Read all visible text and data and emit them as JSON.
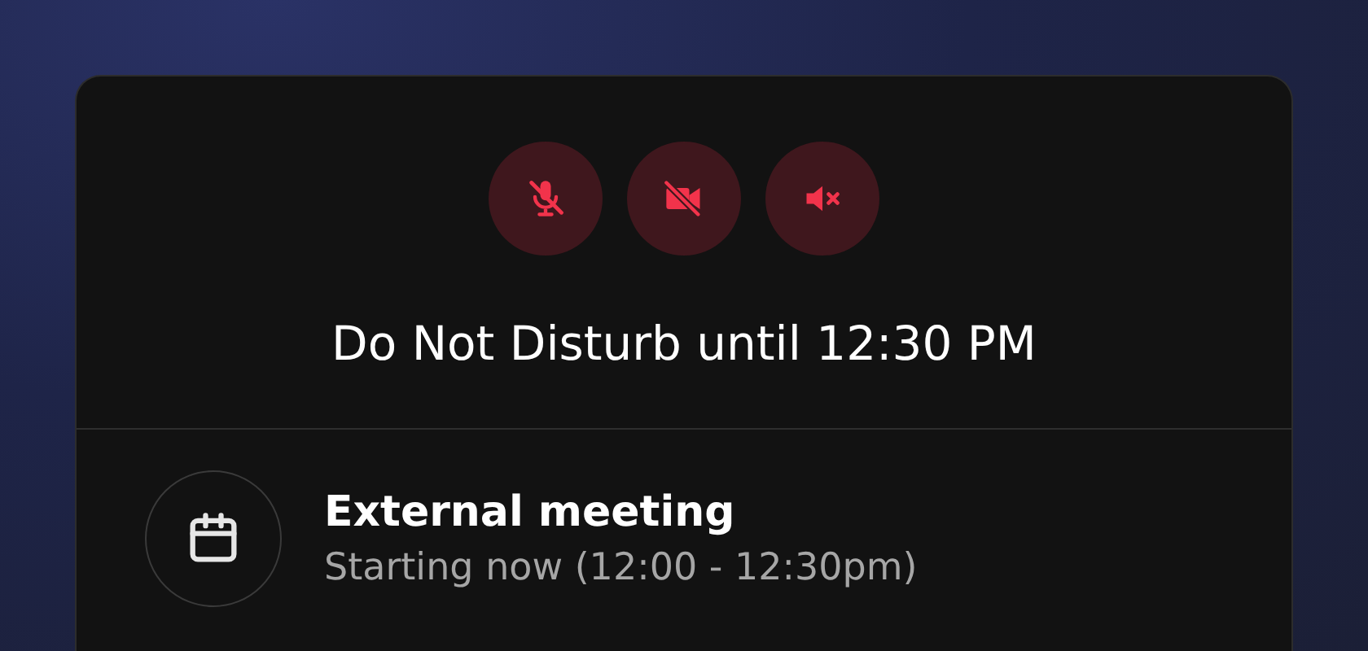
{
  "toggles": [
    {
      "kind": "mic",
      "on": true
    },
    {
      "kind": "camera",
      "on": true
    },
    {
      "kind": "speaker",
      "on": true
    }
  ],
  "status": "Do Not Disturb until 12:30 PM",
  "event": {
    "title": "External meeting",
    "subtitle": "Starting now (12:00 - 12:30pm)"
  }
}
